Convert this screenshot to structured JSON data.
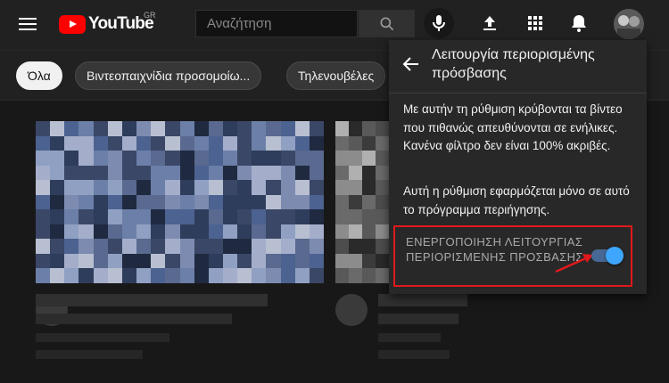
{
  "masthead": {
    "logo_text": "YouTube",
    "country_code": "GR",
    "search_placeholder": "Αναζήτηση",
    "icons": [
      "menu-icon",
      "search-icon",
      "mic-icon",
      "upload-icon",
      "apps-grid-icon",
      "bell-icon"
    ]
  },
  "chips": [
    {
      "label": "Όλα",
      "active": true
    },
    {
      "label": "Βιντεοπαιχνίδια προσομοίω...",
      "active": false
    },
    {
      "label": "Τηλενουβέλες",
      "active": false
    }
  ],
  "restricted_panel": {
    "title": "Λειτουργία περιορισμένης πρόσβασης",
    "description": "Με αυτήν τη ρύθμιση κρύβονται τα βίντεο που πιθανώς απευθύνονται σε ενήλικες. Κανένα φίλτρο δεν είναι 100% ακριβές.",
    "note": "Αυτή η ρύθμιση εφαρμόζεται μόνο σε αυτό το πρόγραμμα περιήγησης.",
    "toggle_label": "ΕΝΕΡΓΟΠΟΙΗΣΗ ΛΕΙΤΟΥΡΓΙΑΣ ΠΕΡΙΟΡΙΣΜΕΝΗΣ ΠΡΟΣΒΑΣΗΣ",
    "toggle_on": true
  },
  "colors": {
    "accent_blue": "#3ea6ff",
    "brand_red": "#ff0000",
    "highlight_red": "#e0191c",
    "background": "#181818"
  }
}
